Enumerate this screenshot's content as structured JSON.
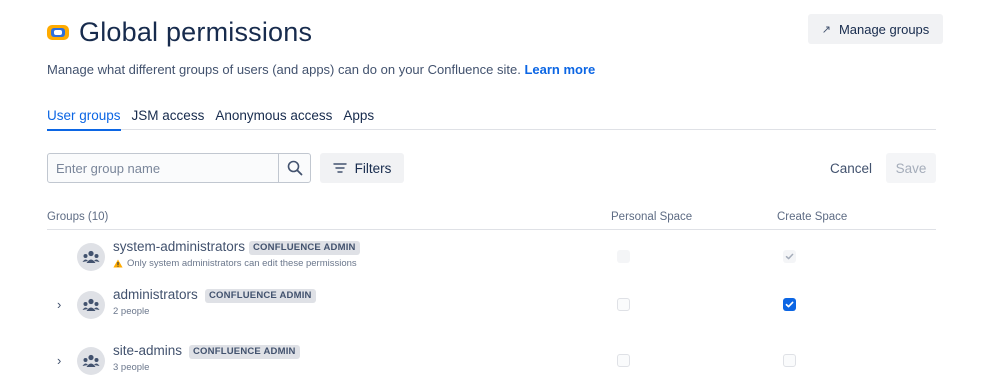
{
  "header": {
    "title": "Global permissions",
    "manage_groups_label": "Manage groups"
  },
  "description": {
    "text": "Manage what different groups of users (and apps) can do on your Confluence site.",
    "link": "Learn more"
  },
  "tabs": [
    {
      "label": "User groups",
      "active": true
    },
    {
      "label": "JSM access",
      "active": false
    },
    {
      "label": "Anonymous access",
      "active": false
    },
    {
      "label": "Apps",
      "active": false
    }
  ],
  "search": {
    "placeholder": "Enter group name",
    "value": ""
  },
  "filters_label": "Filters",
  "actions": {
    "cancel": "Cancel",
    "save": "Save"
  },
  "table": {
    "columns": {
      "groups": "Groups (10)",
      "personal_space": "Personal Space",
      "create_space": "Create Space"
    },
    "rows": [
      {
        "name": "system-administrators",
        "badge": "CONFLUENCE ADMIN",
        "sub": "Only system administrators can edit these permissions",
        "warning": true,
        "expandable": false,
        "personal_space": "disabled",
        "create_space": "checked-disabled"
      },
      {
        "name": "administrators",
        "badge": "CONFLUENCE ADMIN",
        "sub": "2 people",
        "warning": false,
        "expandable": true,
        "personal_space": "unchecked",
        "create_space": "checked"
      },
      {
        "name": "site-admins",
        "badge": "CONFLUENCE ADMIN",
        "sub": "3 people",
        "warning": false,
        "expandable": true,
        "personal_space": "unchecked",
        "create_space": "unchecked"
      }
    ]
  },
  "icons": {
    "title": "confluence-logo-icon",
    "manage": "external-arrow-icon",
    "search": "search-icon",
    "filters": "filter-icon",
    "avatar": "group-icon",
    "warning": "warning-icon",
    "expand": "chevron-right-icon"
  },
  "colors": {
    "accent": "#0c66e4",
    "warning": "#ffab00",
    "text": "#172b4d"
  }
}
